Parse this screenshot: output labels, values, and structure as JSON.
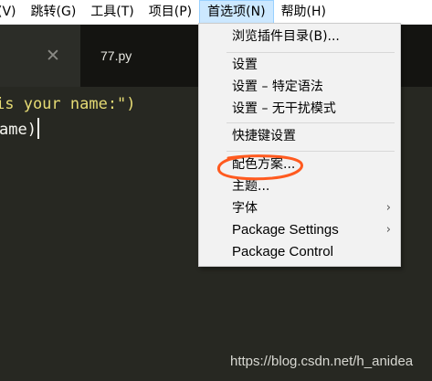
{
  "menubar": {
    "items": [
      {
        "label": "(V)"
      },
      {
        "label": "跳转(G)"
      },
      {
        "label": "工具(T)"
      },
      {
        "label": "项目(P)"
      },
      {
        "label": "首选项(N)"
      },
      {
        "label": "帮助(H)"
      }
    ]
  },
  "tabs": {
    "close_glyph": "✕",
    "active_label": "77.py"
  },
  "editor": {
    "line1": "is your name:\")",
    "line2": "ame)"
  },
  "dropdown": {
    "items": [
      {
        "label": "浏览插件目录(B)..."
      },
      {
        "label": "设置"
      },
      {
        "label": "设置 – 特定语法"
      },
      {
        "label": "设置 – 无干扰模式"
      },
      {
        "label": "快捷键设置"
      },
      {
        "label": "配色方案..."
      },
      {
        "label": "主题..."
      },
      {
        "label": "字体",
        "submenu": true
      },
      {
        "label": "Package Settings",
        "submenu": true
      },
      {
        "label": "Package Control"
      }
    ],
    "submenu_glyph": "›"
  },
  "annotation": {
    "color": "#ff5a1f"
  },
  "watermark": "https://blog.csdn.net/h_anidea"
}
